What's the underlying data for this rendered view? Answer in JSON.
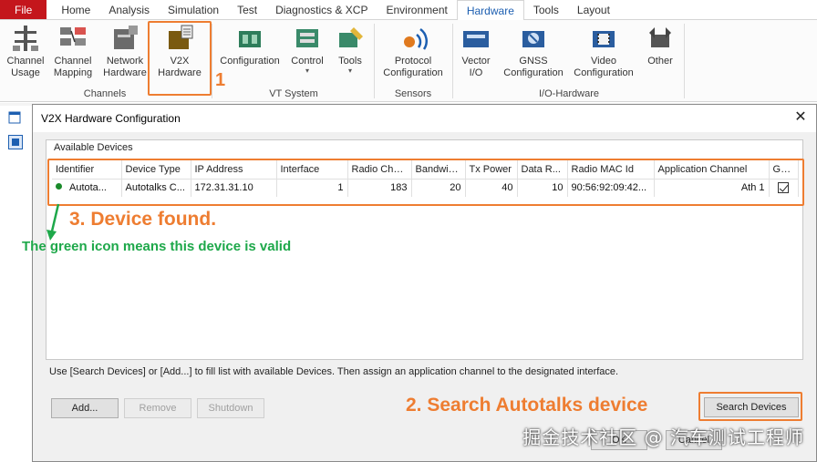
{
  "ribbon_tabs": [
    "File",
    "Home",
    "Analysis",
    "Simulation",
    "Test",
    "Diagnostics & XCP",
    "Environment",
    "Hardware",
    "Tools",
    "Layout"
  ],
  "active_tab": "Hardware",
  "ribbon": {
    "channel_usage": "Channel\nUsage",
    "channel_mapping": "Channel\nMapping",
    "network_hardware": "Network\nHardware",
    "v2x_hardware": "V2X\nHardware",
    "group_channels": "Channels",
    "configuration": "Configuration",
    "control": "Control",
    "tools": "Tools",
    "group_vt_system": "VT System",
    "protocol_configuration": "Protocol\nConfiguration",
    "group_sensors": "Sensors",
    "vector_io": "Vector\nI/O",
    "gnss_configuration": "GNSS\nConfiguration",
    "video_configuration": "Video\nConfiguration",
    "other": "Other",
    "group_io_hardware": "I/O-Hardware"
  },
  "dialog": {
    "title": "V2X Hardware Configuration",
    "available_devices_label": "Available Devices",
    "columns": [
      "Identifier",
      "Device Type",
      "IP Address",
      "Interface",
      "Radio Cha...",
      "Bandwidth",
      "Tx Power",
      "Data R...",
      "Radio MAC Id",
      "Application Channel",
      "GNSS"
    ],
    "rows": [
      {
        "identifier": "Autota...",
        "device_type": "Autotalks C...",
        "ip_address": "172.31.31.10",
        "interface": "1",
        "radio_channel": "183",
        "bandwidth": "20",
        "tx_power": "40",
        "data_rate": "10",
        "radio_mac_id": "90:56:92:09:42...",
        "application_channel": "Ath 1",
        "gnss": true,
        "status_color": "#1a8a2a"
      }
    ],
    "hint": "Use [Search Devices] or [Add...] to fill list with available Devices. Then assign an application channel to the designated interface.",
    "buttons": {
      "add": "Add...",
      "remove": "Remove",
      "shutdown": "Shutdown",
      "search": "Search Devices",
      "ok": "OK",
      "cancel": "Cancel"
    }
  },
  "annotations": {
    "step1": "1",
    "step2": "2. Search Autotalks device",
    "step3": "3. Device found.",
    "green_note": "The green icon means this device is valid",
    "accent": "#ee7d31",
    "green": "#1ea84a"
  },
  "watermark": "掘金技术社区 @ 汽车测试工程师"
}
